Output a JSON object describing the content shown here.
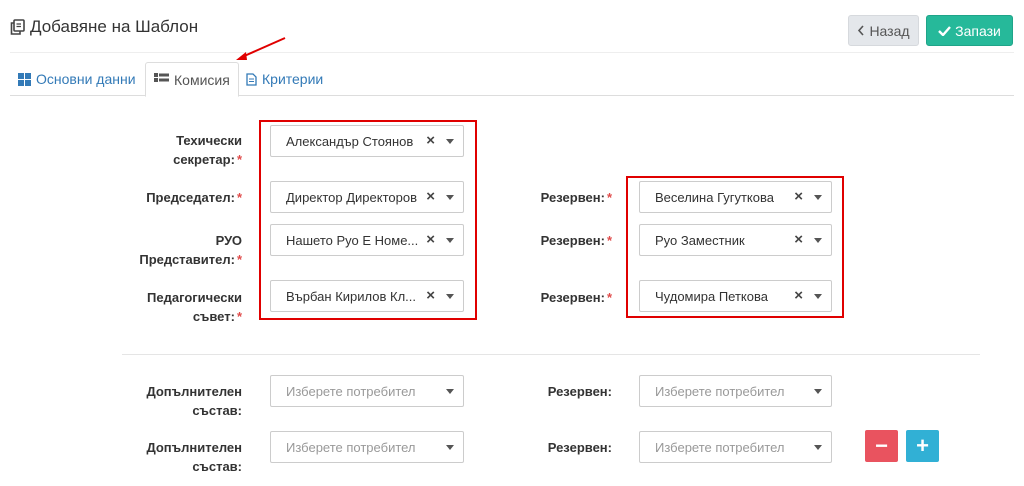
{
  "header": {
    "title": "Добавяне на Шаблон",
    "back_label": "Назад",
    "save_label": "Запази"
  },
  "tabs": [
    {
      "label": "Основни данни"
    },
    {
      "label": "Комисия"
    },
    {
      "label": "Критерии"
    }
  ],
  "form": {
    "required_mark": "*",
    "left": [
      {
        "label_line1": "Техически",
        "label_line2": "секретар:",
        "value": "Александър Стоянов"
      },
      {
        "label_line1": "Председател:",
        "label_line2": "",
        "value": "Директор Директоров"
      },
      {
        "label_line1": "РУО",
        "label_line2": "Представител:",
        "value": "Нашето Руо Е Номе..."
      },
      {
        "label_line1": "Педагогически",
        "label_line2": "съвет:",
        "value": "Върбан Кирилов Кл..."
      }
    ],
    "right": [
      {
        "label": "Резервен:",
        "value": "Веселина Гугуткова"
      },
      {
        "label": "Резервен:",
        "value": "Руо Заместник"
      },
      {
        "label": "Резервен:",
        "value": "Чудомира Петкова"
      }
    ],
    "extra_rows": [
      {
        "label_line1": "Допълнителен",
        "label_line2": "състав:",
        "placeholder": "Изберете потребител",
        "reserve_label": "Резервен:",
        "reserve_placeholder": "Изберете потребител"
      },
      {
        "label_line1": "Допълнителен",
        "label_line2": "състав:",
        "placeholder": "Изберете потребител",
        "reserve_label": "Резервен:",
        "reserve_placeholder": "Изберете потребител"
      }
    ],
    "remove_label": "−",
    "add_label": "+"
  },
  "colors": {
    "accent": "#26b99a",
    "link": "#337ab7",
    "danger": "#e9535f",
    "info": "#31b0d5",
    "highlight": "#e00000"
  },
  "icons": [
    "template-copy-icon",
    "chevron-left-icon",
    "check-icon",
    "grid-icon",
    "list-icon",
    "document-icon",
    "clear-icon",
    "caret-down-icon"
  ]
}
